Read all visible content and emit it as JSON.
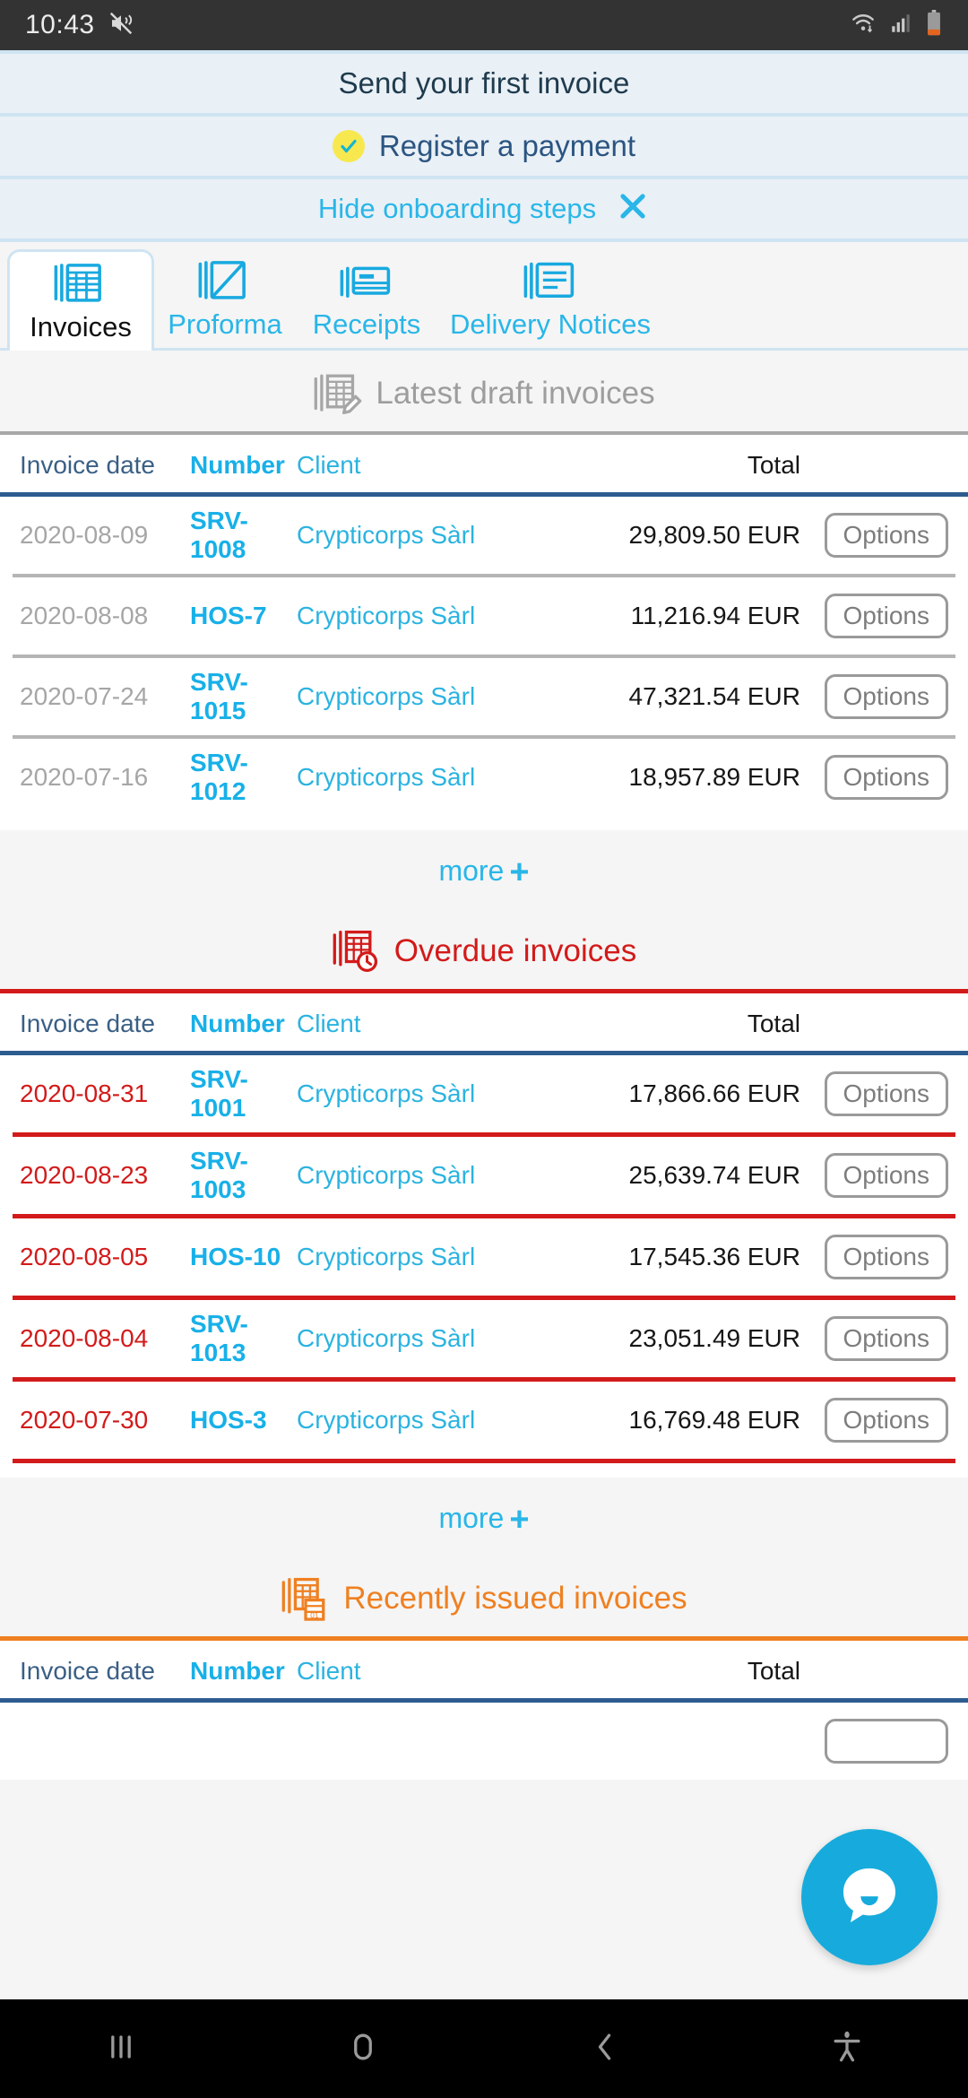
{
  "status_bar": {
    "time": "10:43",
    "icons": [
      "mute-icon",
      "wifi-icon",
      "cellular-signal-icon",
      "battery-icon"
    ]
  },
  "onboarding": {
    "step1_label": "Send your first invoice",
    "step2_label": "Register a payment",
    "hide_label": "Hide onboarding steps"
  },
  "tabs": [
    {
      "label": "Invoices",
      "icon": "invoices-icon",
      "active": true
    },
    {
      "label": "Proforma",
      "icon": "proforma-icon",
      "active": false
    },
    {
      "label": "Receipts",
      "icon": "receipts-icon",
      "active": false
    },
    {
      "label": "Delivery Notices",
      "icon": "delivery-notices-icon",
      "active": false
    }
  ],
  "columns": {
    "date": "Invoice date",
    "number": "Number",
    "client": "Client",
    "total": "Total"
  },
  "options_label": "Options",
  "more_label": "more",
  "more_plus": "+",
  "sections": {
    "draft": {
      "title": "Latest draft invoices",
      "icon": "draft-invoices-icon",
      "color": "#9d9d9d",
      "rows": [
        {
          "date": "2020-08-09",
          "number": "SRV-1008",
          "client": "Crypticorps Sàrl",
          "total": "29,809.50 EUR"
        },
        {
          "date": "2020-08-08",
          "number": "HOS-7",
          "client": "Crypticorps Sàrl",
          "total": "11,216.94 EUR"
        },
        {
          "date": "2020-07-24",
          "number": "SRV-1015",
          "client": "Crypticorps Sàrl",
          "total": "47,321.54 EUR"
        },
        {
          "date": "2020-07-16",
          "number": "SRV-1012",
          "client": "Crypticorps Sàrl",
          "total": "18,957.89 EUR"
        }
      ]
    },
    "overdue": {
      "title": "Overdue invoices",
      "icon": "overdue-invoices-icon",
      "color": "#d31a1a",
      "rows": [
        {
          "date": "2020-08-31",
          "number": "SRV-1001",
          "client": "Crypticorps Sàrl",
          "total": "17,866.66 EUR"
        },
        {
          "date": "2020-08-23",
          "number": "SRV-1003",
          "client": "Crypticorps Sàrl",
          "total": "25,639.74 EUR"
        },
        {
          "date": "2020-08-05",
          "number": "HOS-10",
          "client": "Crypticorps Sàrl",
          "total": "17,545.36 EUR"
        },
        {
          "date": "2020-08-04",
          "number": "SRV-1013",
          "client": "Crypticorps Sàrl",
          "total": "23,051.49 EUR"
        },
        {
          "date": "2020-07-30",
          "number": "HOS-3",
          "client": "Crypticorps Sàrl",
          "total": "16,769.48 EUR"
        }
      ]
    },
    "recent": {
      "title": "Recently issued invoices",
      "icon": "recent-invoices-icon",
      "color": "#ef8021",
      "rows": []
    }
  },
  "chat_fab": {
    "icon": "chat-bubble-icon"
  },
  "nav_bar": {
    "recents": "recents-icon",
    "home": "home-icon",
    "back": "back-icon",
    "accessibility": "accessibility-icon"
  },
  "colors": {
    "accent_cyan": "#29b6e8",
    "link_cyan": "#2bb3e0",
    "overdue_red": "#d31a1a",
    "recent_orange": "#ef8021",
    "header_blue": "#2c5c8f",
    "banner_bg": "#e9f0f6"
  }
}
